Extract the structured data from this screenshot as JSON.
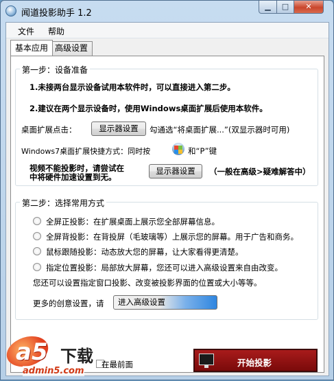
{
  "window": {
    "title": "闻道投影助手 1.2",
    "min_glyph": "▁",
    "max_glyph": "□",
    "close_glyph": "✕"
  },
  "menu": {
    "items": [
      "文件",
      "帮助"
    ]
  },
  "tabs": [
    "基本应用",
    "高级设置"
  ],
  "step1": {
    "title": "第一步：设备准备",
    "line1": "1.未接两台显示设备试用本软件时，可以直接进入第二步。",
    "line2": "2.建议在两个显示设备时，使用Windows桌面扩展后使用本软件。",
    "extend_label": "桌面扩展点击：",
    "display_settings_btn": "显示器设置",
    "extend_hint": "勾通选“将桌面扩展...”(双显示器时可用)",
    "shortcut_prefix": "Windows7桌面扩展快捷方式：同时按",
    "shortcut_suffix": "和“P”键",
    "cannot_project_line1": "视频不能投影时，请尝试在",
    "cannot_project_line2": "中将硬件加速设置到无。",
    "display_settings_btn2": "显示器设置",
    "advanced_hint": "（一般在高级>疑难解答中）"
  },
  "step2": {
    "title": "第二步：选择常用方式",
    "options": [
      "全屏正投影：在扩展桌面上展示您全部屏幕信息。",
      "全屏背投影：在背投屏（毛玻璃等）上展示您的屏幕。用于广告和商务。",
      "鼠标跟随投影：动态放大您的屏幕，让大家看得更清楚。",
      "指定位置投影：局部放大屏幕，您还可以进入高级设置来自由改变。"
    ],
    "more_info": "您还可以设置指定窗口投影、改变被投影界面的位置或大小等等。",
    "creative_label": "更多的创意设置，请",
    "advanced_btn": "进入高级设置"
  },
  "bottom": {
    "topmost_label": "在最前面",
    "start_btn": "开始投影"
  },
  "watermark": {
    "brand": "a5",
    "text": "下载",
    "site": "admin5.com"
  }
}
